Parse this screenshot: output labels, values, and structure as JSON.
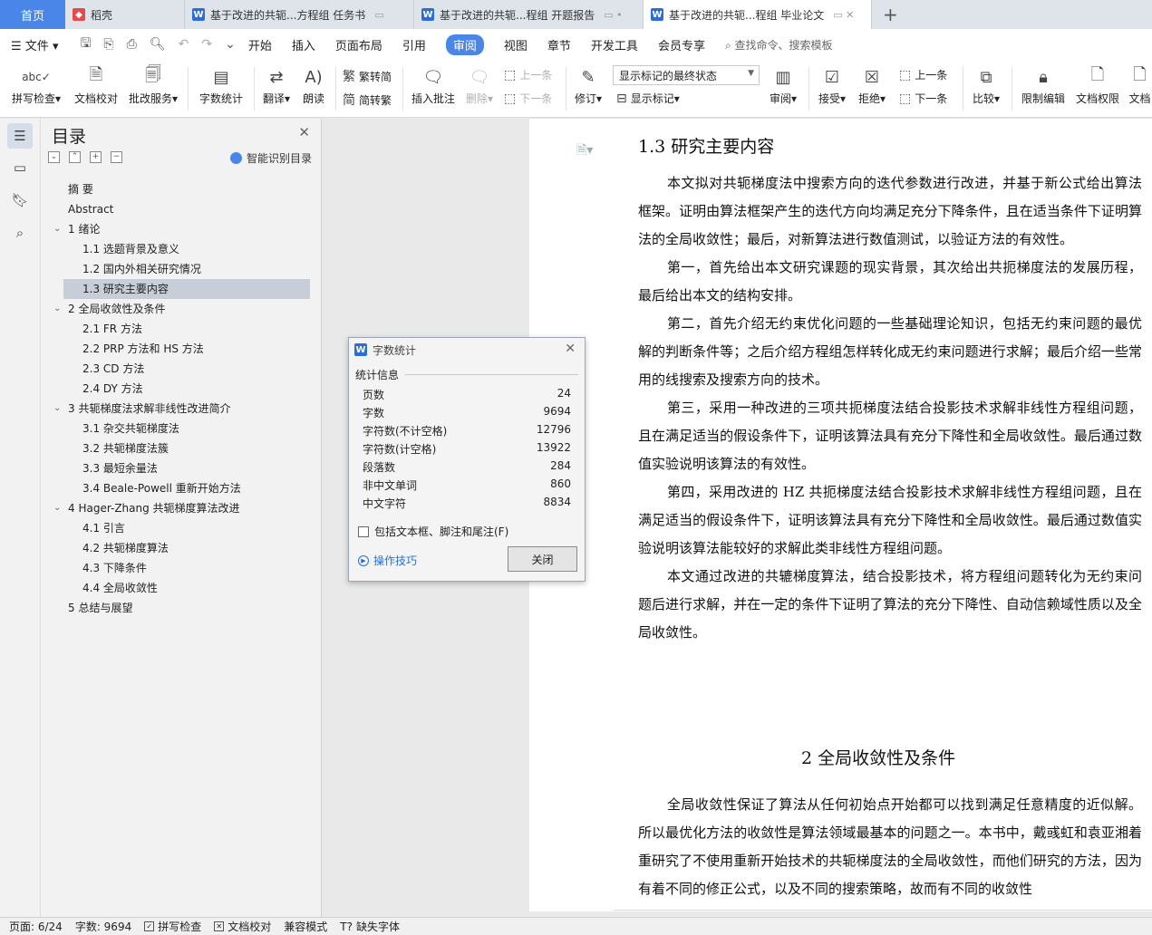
{
  "tabs": {
    "home": "首页",
    "items": [
      {
        "icon": "docer-icon",
        "label": "稻壳"
      },
      {
        "icon": "word-doc-icon",
        "label": "基于改进的共轭...方程组 任务书"
      },
      {
        "icon": "word-doc-icon",
        "label": "基于改进的共轭...程组 开题报告"
      },
      {
        "icon": "word-doc-icon",
        "label": "基于改进的共轭...程组 毕业论文"
      }
    ],
    "add": "+"
  },
  "menu": {
    "file": "文件",
    "items": [
      "开始",
      "插入",
      "页面布局",
      "引用",
      "审阅",
      "视图",
      "章节",
      "开发工具",
      "会员专享"
    ],
    "active": "审阅",
    "search": "查找命令、搜索模板"
  },
  "ribbon": {
    "spell_check": "拼写检查",
    "doc_proof": "文档校对",
    "batch_service": "批改服务",
    "word_count": "字数统计",
    "translate": "翻译",
    "read_aloud": "朗读",
    "trad_convert": "繁转简",
    "simp_convert": "简转繁",
    "insert_comment": "插入批注",
    "delete": "删除",
    "prev_comment": "上一条",
    "next_comment": "下一条",
    "track_changes": "修订",
    "markup_mode": "显示标记的最终状态",
    "show_markup": "显示标记",
    "review": "审阅",
    "accept": "接受",
    "reject": "拒绝",
    "prev_change": "上一条",
    "next_change": "下一条",
    "compare": "比较",
    "restrict_edit": "限制编辑",
    "doc_permission": "文档权限",
    "doc_more": "文档"
  },
  "toc": {
    "title": "目录",
    "smart": "智能识别目录",
    "items": [
      {
        "label": "摘  要",
        "level": 1,
        "chev": false
      },
      {
        "label": "Abstract",
        "level": 1,
        "chev": false
      },
      {
        "label": "1 绪论",
        "level": 1,
        "chev": true
      },
      {
        "label": "1.1 选题背景及意义",
        "level": 2,
        "chev": false
      },
      {
        "label": "1.2 国内外相关研究情况",
        "level": 2,
        "chev": false
      },
      {
        "label": "1.3 研究主要内容",
        "level": 2,
        "chev": false,
        "selected": true
      },
      {
        "label": "2  全局收敛性及条件",
        "level": 1,
        "chev": true
      },
      {
        "label": "2.1 FR 方法",
        "level": 2,
        "chev": false
      },
      {
        "label": "2.2 PRP 方法和 HS 方法",
        "level": 2,
        "chev": false
      },
      {
        "label": "2.3 CD 方法",
        "level": 2,
        "chev": false
      },
      {
        "label": "2.4 DY 方法",
        "level": 2,
        "chev": false
      },
      {
        "label": "3  共轭梯度法求解非线性改进简介",
        "level": 1,
        "chev": true
      },
      {
        "label": "3.1  杂交共轭梯度法",
        "level": 2,
        "chev": false
      },
      {
        "label": "3.2  共轭梯度法簇",
        "level": 2,
        "chev": false
      },
      {
        "label": "3.3  最短余量法",
        "level": 2,
        "chev": false
      },
      {
        "label": "3.4 Beale-Powell 重新开始方法",
        "level": 2,
        "chev": false
      },
      {
        "label": "4 Hager-Zhang 共轭梯度算法改进",
        "level": 1,
        "chev": true
      },
      {
        "label": "4.1  引言",
        "level": 2,
        "chev": false
      },
      {
        "label": "4.2  共轭梯度算法",
        "level": 2,
        "chev": false
      },
      {
        "label": "4.3  下降条件",
        "level": 2,
        "chev": false
      },
      {
        "label": "4.4  全局收敛性",
        "level": 2,
        "chev": false
      },
      {
        "label": "5  总结与展望",
        "level": 1,
        "chev": false
      }
    ]
  },
  "document": {
    "heading_13": "1.3 研究主要内容",
    "paragraphs": [
      "本文拟对共轭梯度法中搜索方向的迭代参数进行改进，并基于新公式给出算法框架。证明由算法框架产生的迭代方向均满足充分下降条件，且在适当条件下证明算法的全局收敛性；最后，对新算法进行数值测试，以验证方法的有效性。",
      "第一，首先给出本文研究课题的现实背景，其次给出共扼梯度法的发展历程，最后给出本文的结构安排。",
      "第二，首先介绍无约束优化问题的一些基础理论知识，包括无约束问题的最优解的判断条件等；之后介绍方程组怎样转化成无约束问题进行求解；最后介绍一些常用的线搜索及搜索方向的技术。",
      "第三，采用一种改进的三项共扼梯度法结合投影技术求解非线性方程组问题，且在满足适当的假设条件下，证明该算法具有充分下降性和全局收敛性。最后通过数值实验说明该算法的有效性。",
      "第四，采用改进的 HZ 共扼梯度法结合投影技术求解非线性方程组问题，且在满足适当的假设条件下，证明该算法具有充分下降性和全局收敛性。最后通过数值实验说明该算法能较好的求解此类非线性方程组问题。",
      "本文通过改进的共辘梯度算法，结合投影技术，将方程组问题转化为无约束问题后进行求解，并在一定的条件下证明了算法的充分下降性、自动信赖域性质以及全局收敛性。"
    ],
    "heading_2": "2  全局收敛性及条件",
    "paragraph_2": "全局收敛性保证了算法从任何初始点开始都可以找到满足任意精度的近似解。所以最优化方法的收敛性是算法领域最基本的问题之一。本书中，戴彧虹和袁亚湘着重研究了不使用重新开始技术的共轭梯度法的全局收敛性，而他们研究的方法，因为有着不同的修正公式，以及不同的搜索策略，故而有不同的收敛性"
  },
  "dialog": {
    "title": "字数统计",
    "section": "统计信息",
    "stats": [
      {
        "label": "页数",
        "value": "24"
      },
      {
        "label": "字数",
        "value": "9694"
      },
      {
        "label": "字符数(不计空格)",
        "value": "12796"
      },
      {
        "label": "字符数(计空格)",
        "value": "13922"
      },
      {
        "label": "段落数",
        "value": "284"
      },
      {
        "label": "非中文单词",
        "value": "860"
      },
      {
        "label": "中文字符",
        "value": "8834"
      }
    ],
    "checkbox": "包括文本框、脚注和尾注(F)",
    "tips": "操作技巧",
    "close": "关闭"
  },
  "status": {
    "page": "页面: 6/24",
    "words": "字数: 9694",
    "spell": "拼写检查",
    "proof": "文档校对",
    "compat": "兼容模式",
    "missing_font": "缺失字体"
  }
}
